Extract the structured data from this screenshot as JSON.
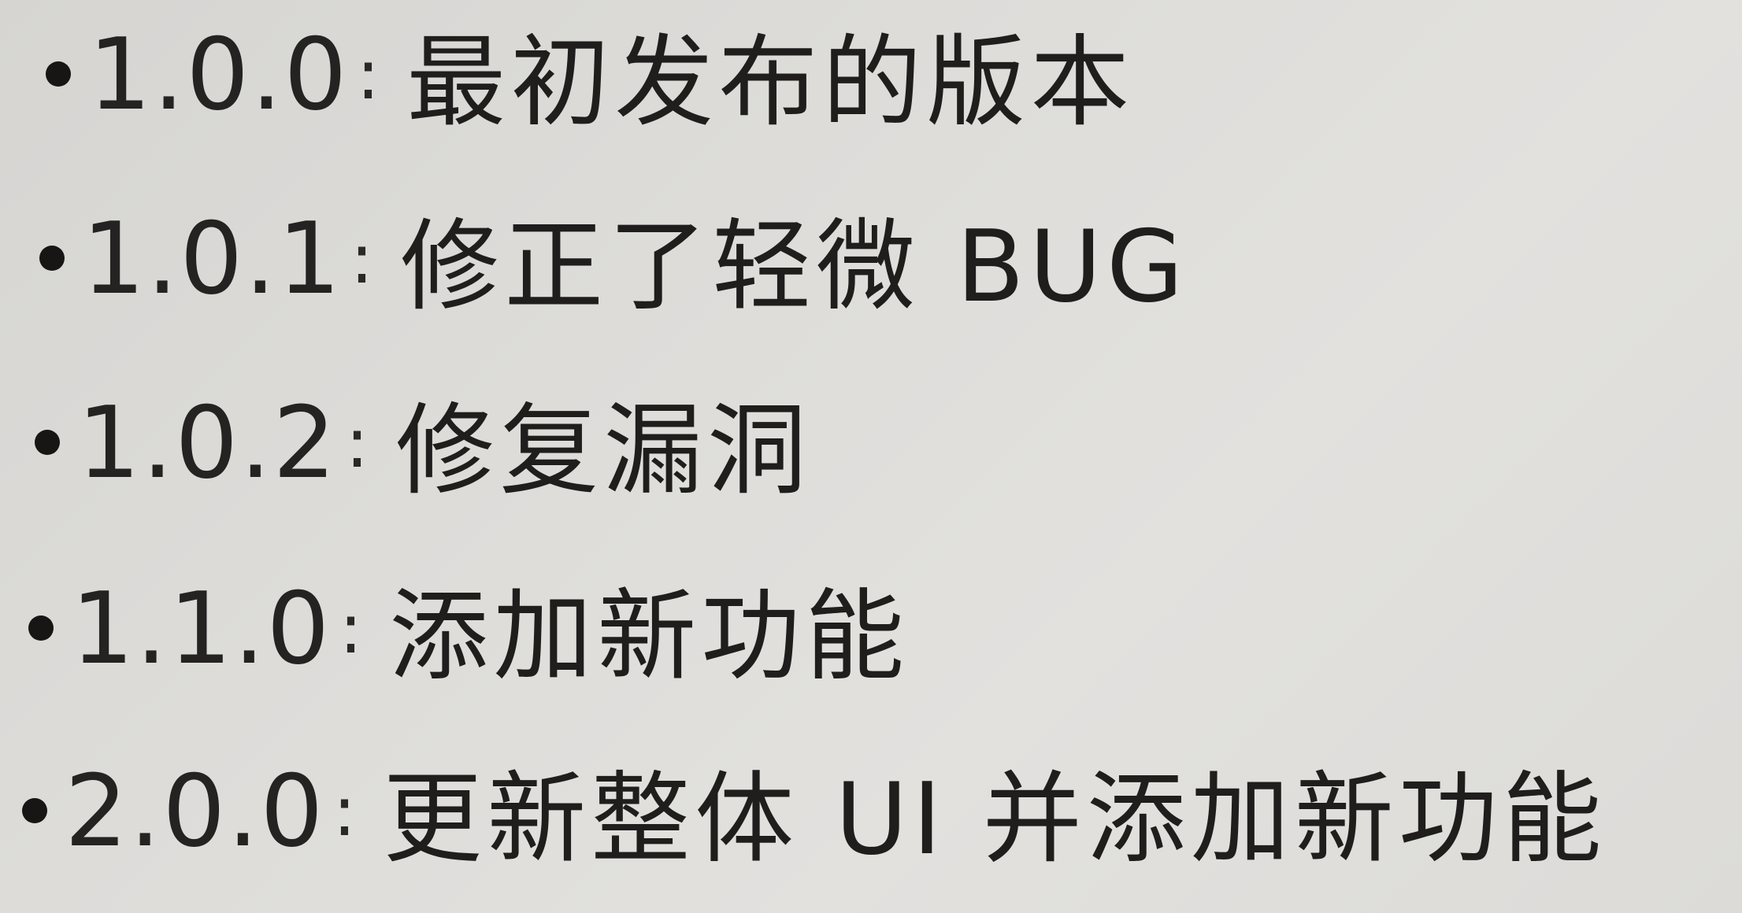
{
  "version_history": {
    "items": [
      {
        "version": "1.0.0",
        "separator": ":",
        "description": "最初发布的版本"
      },
      {
        "version": "1.0.1",
        "separator": ":",
        "description": "修正了轻微 BUG"
      },
      {
        "version": "1.0.2",
        "separator": ":",
        "description": "修复漏洞"
      },
      {
        "version": "1.1.0",
        "separator": ":",
        "description": "添加新功能"
      },
      {
        "version": "2.0.0",
        "separator": ":",
        "description": "更新整体 UI 并添加新功能"
      }
    ]
  },
  "colors": {
    "paper": "#dddcd9",
    "ink": "#1e1d1c"
  }
}
